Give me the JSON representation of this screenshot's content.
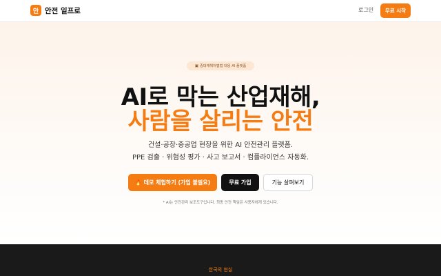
{
  "header": {
    "logo_char": "안",
    "brand": "안전 일프로",
    "login_label": "로그인",
    "start_label": "무료 시작"
  },
  "hero": {
    "badge_icon": "building-icon",
    "badge_text": "중대재해처벌법 대응 AI 플랫폼",
    "title_line1": "AI로 막는 산업재해,",
    "title_line2": "사람을 살리는 안전",
    "subtitle_line1": "건설·공장·중공업 현장을 위한 AI 안전관리 플랫폼.",
    "subtitle_line2": "PPE 검출 · 위험성 평가 · 사고 보고서 · 컴플라이언스 자동화.",
    "demo_icon": "flame-icon",
    "demo_label": "데모 체험하기 (가입 불필요)",
    "free_label": "무료 가입",
    "features_label": "기능 살펴보기",
    "disclaimer": "* AI는 안전관리 보조도구입니다. 최종 안전 책임은 사용자에게 있습니다."
  },
  "section": {
    "label": "한국의 현실"
  },
  "colors": {
    "accent": "#f47c12",
    "dark": "#1a1a1a"
  }
}
